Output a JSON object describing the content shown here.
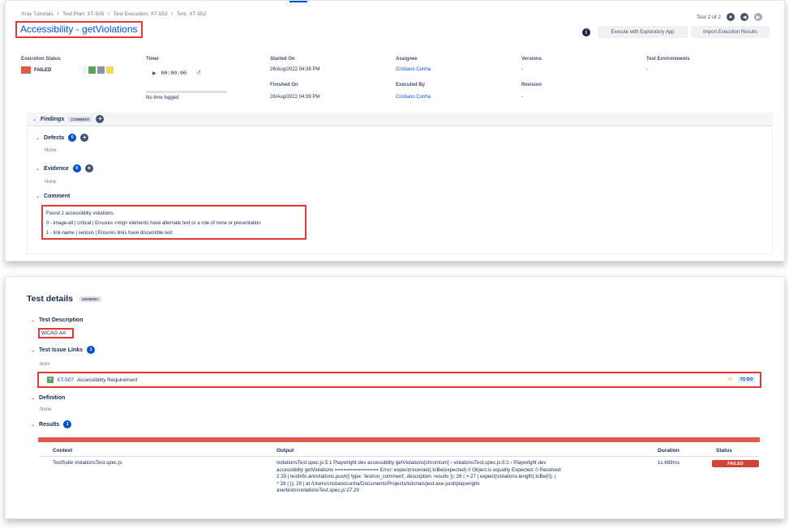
{
  "breadcrumbs": [
    "Xray Tutorials",
    "/",
    "Test Plan: XT-505",
    "/",
    "Test Execution: XT-553",
    "/",
    "Test: XT-552"
  ],
  "header": {
    "title": "Accessibility - getViolations",
    "pager_text": "Test 2 of 2",
    "info_icon": "info-icon",
    "btn_exploratory": "Execute with Exploratory App",
    "btn_import": "Import Execution Results"
  },
  "execution": {
    "status_label": "Execution Status",
    "status_value": "FAILED",
    "status_color": "#de5c4a",
    "swatch_colors": [
      "#57a55a",
      "#8993a4",
      "#f4d65b"
    ],
    "timer_label": "Timer",
    "timer_value": "00:00:00",
    "time_logged": "No time logged",
    "started_label": "Started On",
    "started_value": "26/Aug/2022 04:39 PM",
    "finished_label": "Finished On",
    "finished_value": "26/Aug/2022 04:39 PM",
    "assignee_label": "Assignee",
    "assignee_value": "Cristiano Cunha",
    "executed_label": "Executed By",
    "executed_value": "Cristiano Cunha",
    "versions_label": "Versions",
    "versions_value": "-",
    "revision_label": "Revision",
    "revision_value": "-",
    "envs_label": "Test Environments",
    "envs_value": "-"
  },
  "findings": {
    "title": "Findings",
    "tag": "COMMENT",
    "defects_title": "Defects",
    "defects_count": "0",
    "defects_value": "None",
    "evidence_title": "Evidence",
    "evidence_count": "0",
    "evidence_value": "None",
    "comment_title": "Comment",
    "comment_lines": [
      "Found 2 accessibility violations.",
      "0 - image-alt | critical | Ensures <img> elements have alternate text or a role of none or presentation",
      "1 - link-name | serious | Ensures links have discernible text"
    ]
  },
  "details": {
    "title": "Test details",
    "tag": "GENERIC",
    "description_title": "Test Description",
    "description_value": "WCAG AA",
    "links_title": "Test Issue Links",
    "links_count": "1",
    "links_relation": "tests",
    "link_key": "XT-507",
    "link_summary": "Accessibility Requirement",
    "link_status": "TO DO",
    "definition_title": "Definition",
    "definition_value": "None",
    "results_title": "Results",
    "results_count": "1",
    "results_headers": [
      "Context",
      "Output",
      "Duration",
      "Status"
    ],
    "result_context": "TestSuite violationsTest.spec.js",
    "result_output_lines": [
      "violationsTest.spec.js:5:1 Playwright dev accessibility getViolations[chromium] › violationsTest.spec.js:5:1 › Playwright dev",
      "accessibility getViolations =============== Error: expect(received).toBe(expected) // Object.is equality Expected: 0 Received:",
      "2 25 | testInfo.annotations.push({ type: 'testrun_comment', description: results }); 26 | > 27 | expect(violations.length).toBe(0); |",
      "^ 28 | }); 29 | at /Users/cristianocunha/Documents/Projects/tutorials/jest-axe-junit/playwright-",
      "axe/tests/violationsTest.spec.js:27:29"
    ],
    "result_duration": "1s 689ms",
    "result_status": "FAILED"
  }
}
